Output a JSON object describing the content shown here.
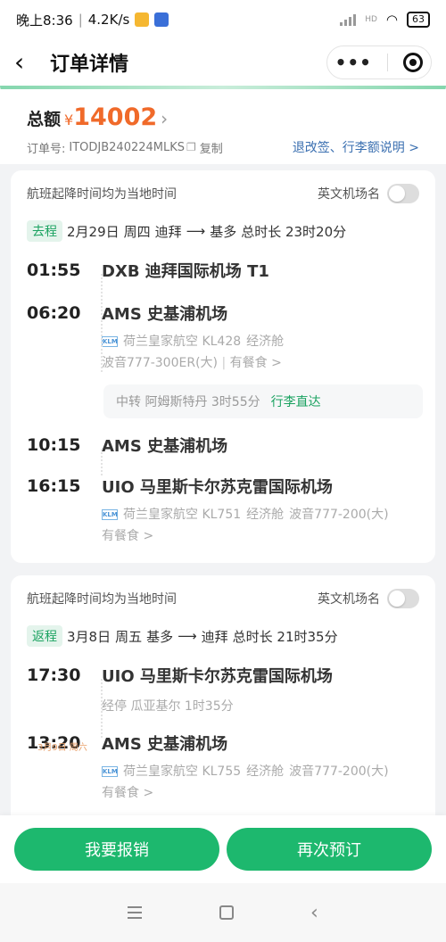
{
  "status_bar": {
    "time": "晚上8:36",
    "net_speed": "4.2K/s",
    "hd_label": "HD",
    "battery": "63"
  },
  "nav": {
    "title": "订单详情",
    "more_label": "•••"
  },
  "summary": {
    "total_label": "总额",
    "currency": "¥",
    "amount": "14002",
    "order_no_label": "订单号:",
    "order_no": "ITODJB240224MLKS",
    "copy_label": "复制",
    "policy_link": "退改签、行李额说明 >"
  },
  "cards": [
    {
      "notice": "航班起降时间均为当地时间",
      "toggle_label": "英文机场名",
      "leg_tag": "去程",
      "date": "2月29日",
      "weekday": "周四",
      "route_from": "迪拜",
      "route_arrow": "⟶",
      "route_to": "基多",
      "duration": "总时长 23时20分",
      "segments": [
        {
          "dep_time": "01:55",
          "dep_airport": "DXB 迪拜国际机场 T1",
          "arr_time": "06:20",
          "arr_airport": "AMS 史基浦机场",
          "airline": "荷兰皇家航空 KL428",
          "cabin": "经济舱",
          "aircraft": "波音777-300ER(大)",
          "meal": "有餐食 >"
        },
        {
          "dep_time": "10:15",
          "dep_airport": "AMS 史基浦机场",
          "arr_time": "16:15",
          "arr_airport": "UIO 马里斯卡尔苏克雷国际机场",
          "airline": "荷兰皇家航空 KL751",
          "cabin": "经济舱",
          "aircraft": "波音777-200(大)",
          "meal": "有餐食 >"
        }
      ],
      "transfer": {
        "text": "中转 阿姆斯特丹 3时55分",
        "luggage": "行李直达"
      }
    },
    {
      "notice": "航班起降时间均为当地时间",
      "toggle_label": "英文机场名",
      "leg_tag": "返程",
      "date": "3月8日",
      "weekday": "周五",
      "route_from": "基多",
      "route_arrow": "⟶",
      "route_to": "迪拜",
      "duration": "总时长 21时35分",
      "segments": [
        {
          "dep_time": "17:30",
          "dep_airport": "UIO 马里斯卡尔苏克雷国际机场",
          "stopover": "经停 瓜亚基尔 1时35分",
          "next_day_note": "3月9日 周六",
          "arr_time": "13:20",
          "arr_airport": "AMS 史基浦机场",
          "airline": "荷兰皇家航空 KL755",
          "cabin": "经济舱",
          "aircraft": "波音777-200(大)",
          "meal": "有餐食 >"
        }
      ]
    }
  ],
  "actions": {
    "reimburse": "我要报销",
    "rebook": "再次预订"
  },
  "icons": {
    "back": "chevron-left-icon",
    "more": "more-dots-icon",
    "target": "target-icon",
    "copy": "copy-icon",
    "airline_logo": "klm-logo-icon"
  }
}
